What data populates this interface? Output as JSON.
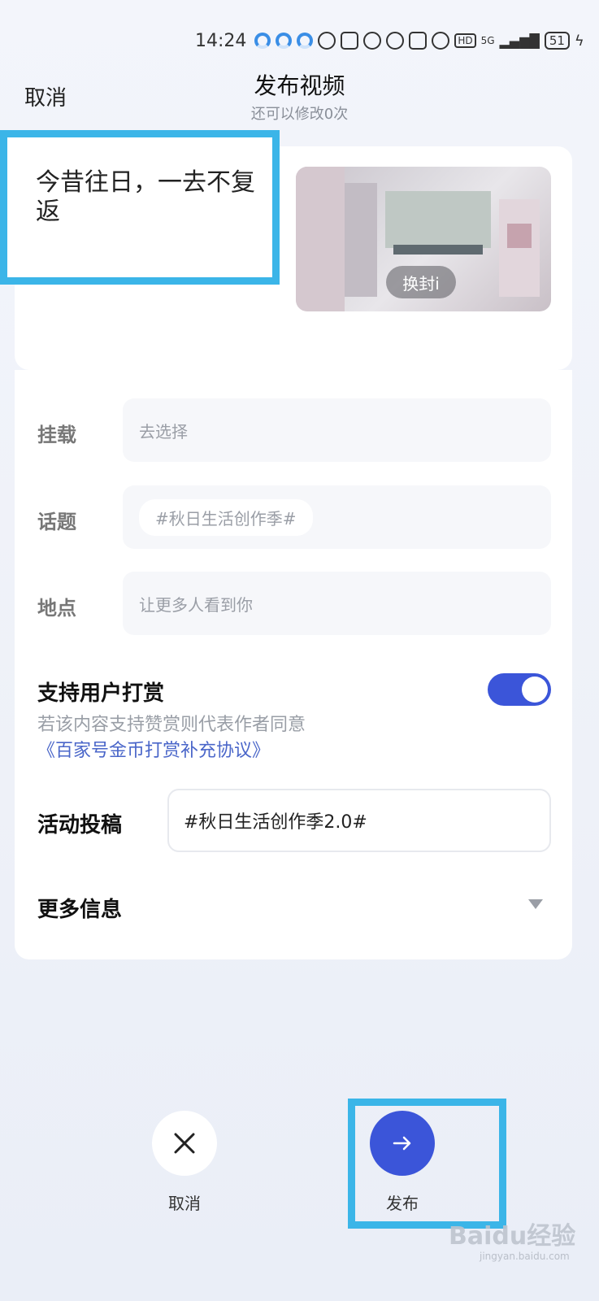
{
  "status_bar": {
    "time": "14:24",
    "network_badge": "HD",
    "signal_label": "5G",
    "battery": "51"
  },
  "header": {
    "cancel_label": "取消",
    "title": "发布视频",
    "subtitle": "还可以修改0次"
  },
  "post": {
    "caption": "今昔往日，一去不复返",
    "cover_button_label": "换封i"
  },
  "form": {
    "mount": {
      "label": "挂载",
      "placeholder": "去选择"
    },
    "topic": {
      "label": "话题",
      "tag": "#秋日生活创作季#"
    },
    "location": {
      "label": "地点",
      "placeholder": "让更多人看到你"
    },
    "reward": {
      "title": "支持用户打赏",
      "enabled": true,
      "description": "若该内容支持赞赏则代表作者同意",
      "agreement_link": "《百家号金币打赏补充协议》"
    },
    "activity": {
      "label": "活动投稿",
      "value": "#秋日生活创作季2.0#"
    },
    "more": {
      "label": "更多信息"
    }
  },
  "actions": {
    "cancel_label": "取消",
    "publish_label": "发布"
  },
  "watermark": {
    "brand": "Baidu经验",
    "url": "jingyan.baidu.com"
  },
  "colors": {
    "accent": "#3b55d9",
    "highlight_box": "#3bb5e8",
    "link": "#4a66c9"
  }
}
